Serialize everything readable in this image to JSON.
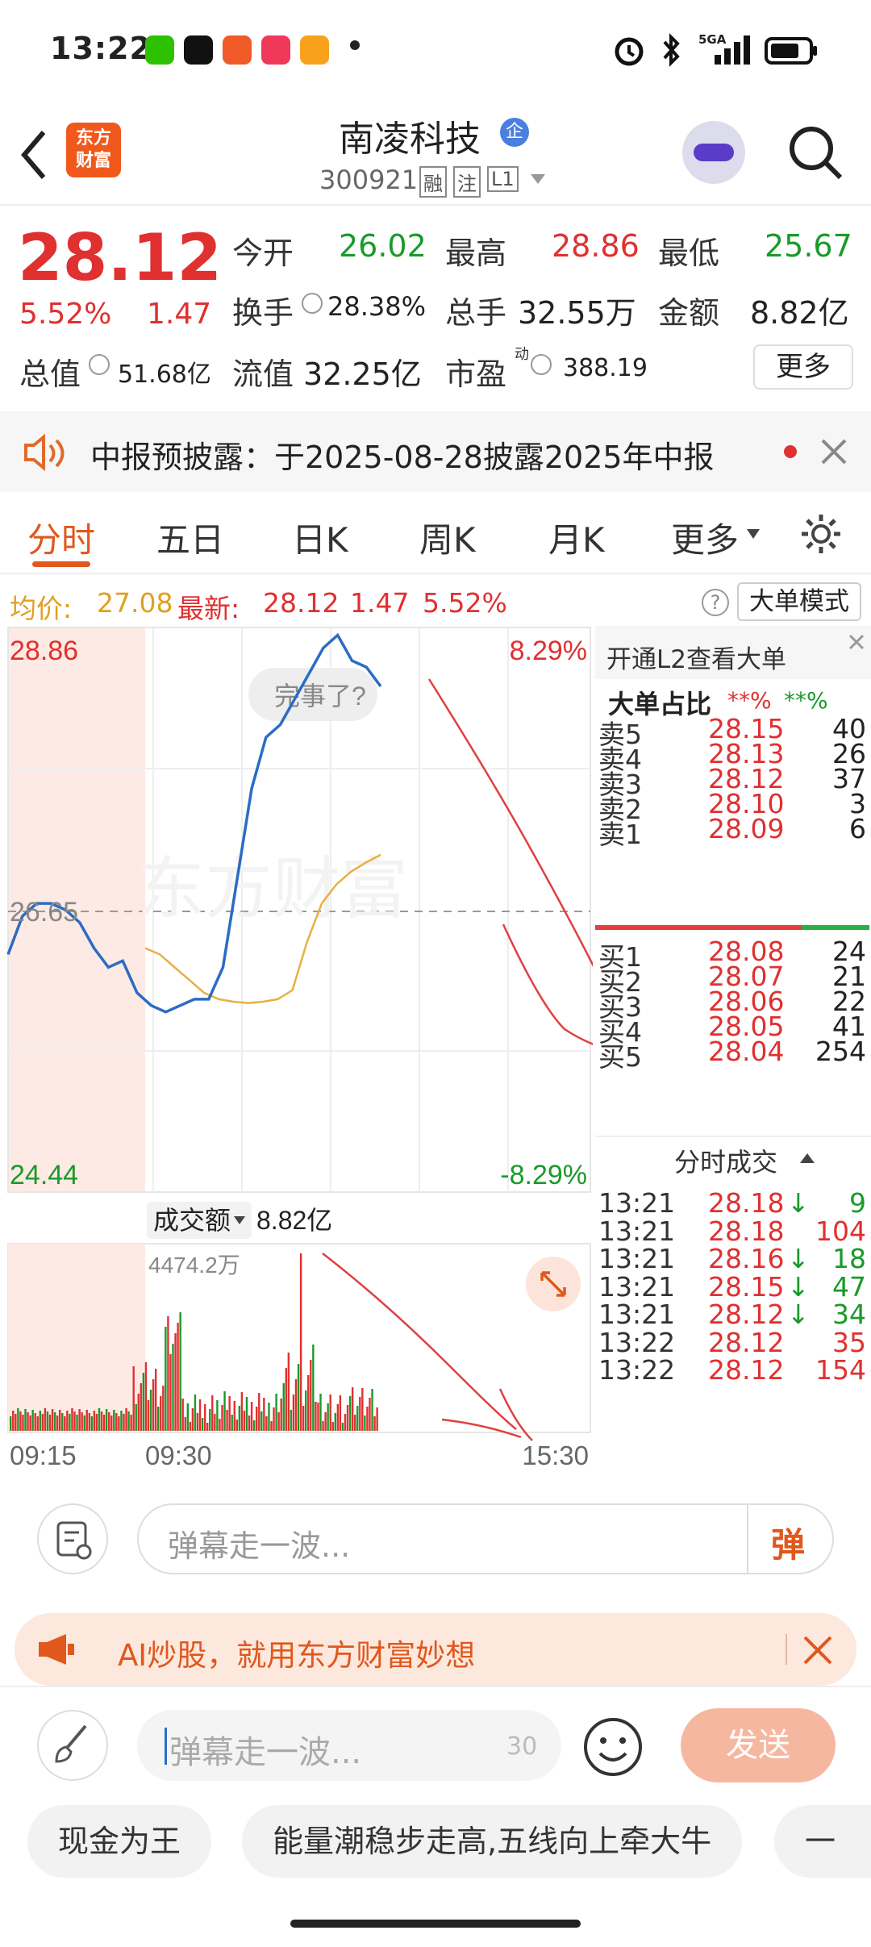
{
  "status_bar": {
    "time": "13:22",
    "network": "5GA"
  },
  "header": {
    "logo_line1": "东方",
    "logo_line2": "财富",
    "stock_name": "南凌科技",
    "name_badge": "企",
    "stock_code": "300921",
    "tags": [
      "融",
      "注",
      "L1"
    ]
  },
  "quote": {
    "price": "28.12",
    "change_pct": "5.52%",
    "change_amt": "1.47",
    "open_label": "今开",
    "open": "26.02",
    "high_label": "最高",
    "high": "28.86",
    "low_label": "最低",
    "low": "25.67",
    "turnover_label": "换手",
    "turnover": "28.38%",
    "volume_label": "总手",
    "volume": "32.55万",
    "amount_label": "金额",
    "amount": "8.82亿",
    "mktcap_label": "总值",
    "mktcap": "51.68亿",
    "float_label": "流值",
    "float_cap": "32.25亿",
    "pe_label": "市盈",
    "pe_sup": "动",
    "pe": "388.19",
    "more_button": "更多"
  },
  "notice": {
    "text": "中报预披露：于2025-08-28披露2025年中报"
  },
  "tabs": [
    "分时",
    "五日",
    "日K",
    "周K",
    "月K",
    "更多"
  ],
  "info_line": {
    "avg_label": "均价:",
    "avg_value": "27.08",
    "latest_label": "最新:",
    "latest_value": "28.12",
    "latest_chg": "1.47",
    "latest_pct": "5.52%",
    "mode_button": "大单模式"
  },
  "chart_labels": {
    "high": "28.86",
    "high_pct": "8.29%",
    "low": "24.44",
    "low_pct": "-8.29%",
    "prev_close": "26.65",
    "watermark": "东方财富",
    "bubble": "完事了?",
    "volume_selector": "成交额",
    "volume_total": "8.82亿",
    "volume_max": "4474.2万",
    "time_start": "09:15",
    "time_open": "09:30",
    "time_end": "15:30"
  },
  "chart_data": {
    "type": "line",
    "ylim": [
      24.44,
      28.86
    ],
    "prev_close": 26.65,
    "series": [
      {
        "values": [
          26.3,
          26.6,
          26.7,
          26.7,
          26.65,
          26.55,
          26.35,
          26.2,
          26.25,
          26.0,
          25.9,
          25.85,
          25.9,
          25.95,
          25.95,
          26.2,
          26.9,
          27.6,
          28.0,
          28.1,
          28.3,
          28.5,
          28.7,
          28.8,
          28.6,
          28.55,
          28.4
        ]
      },
      {
        "values": [
          26.35,
          26.3,
          26.2,
          26.1,
          26.0,
          25.95,
          25.93,
          25.92,
          25.93,
          25.95,
          26.02,
          26.4,
          26.7,
          26.85,
          26.95,
          27.02,
          27.08
        ]
      }
    ],
    "volume_max": "4474.2万"
  },
  "order_book": {
    "promo": "开通L2查看大单",
    "ratio_label": "大单占比",
    "ratio_red": "**%",
    "ratio_green": "**%",
    "asks": [
      {
        "label": "卖5",
        "price": "28.15",
        "vol": "40"
      },
      {
        "label": "卖4",
        "price": "28.13",
        "vol": "26"
      },
      {
        "label": "卖3",
        "price": "28.12",
        "vol": "37"
      },
      {
        "label": "卖2",
        "price": "28.10",
        "vol": "3"
      },
      {
        "label": "卖1",
        "price": "28.09",
        "vol": "6"
      }
    ],
    "bids": [
      {
        "label": "买1",
        "price": "28.08",
        "vol": "24"
      },
      {
        "label": "买2",
        "price": "28.07",
        "vol": "21"
      },
      {
        "label": "买3",
        "price": "28.06",
        "vol": "22"
      },
      {
        "label": "买4",
        "price": "28.05",
        "vol": "41"
      },
      {
        "label": "买5",
        "price": "28.04",
        "vol": "254"
      }
    ],
    "trades_title": "分时成交",
    "trades": [
      {
        "time": "13:21",
        "price": "28.18",
        "arrow": "↓",
        "vol": "9",
        "vcolor": "#1a9a2a"
      },
      {
        "time": "13:21",
        "price": "28.18",
        "arrow": "",
        "vol": "104",
        "vcolor": "#e03030"
      },
      {
        "time": "13:21",
        "price": "28.16",
        "arrow": "↓",
        "vol": "18",
        "vcolor": "#1a9a2a"
      },
      {
        "time": "13:21",
        "price": "28.15",
        "arrow": "↓",
        "vol": "47",
        "vcolor": "#1a9a2a"
      },
      {
        "time": "13:21",
        "price": "28.12",
        "arrow": "↓",
        "vol": "34",
        "vcolor": "#1a9a2a"
      },
      {
        "time": "13:22",
        "price": "28.12",
        "arrow": "",
        "vol": "35",
        "vcolor": "#e03030"
      },
      {
        "time": "13:22",
        "price": "28.12",
        "arrow": "",
        "vol": "154",
        "vcolor": "#e03030"
      }
    ]
  },
  "danmu": {
    "placeholder": "弹幕走一波...",
    "toggle": "弹"
  },
  "ad": {
    "text": "AI炒股，就用东方财富妙想"
  },
  "input": {
    "placeholder": "弹幕走一波...",
    "count": "30",
    "send": "发送"
  },
  "chips": [
    "现金为王",
    "能量潮稳步走高,五线向上牵大牛",
    "一朝"
  ]
}
